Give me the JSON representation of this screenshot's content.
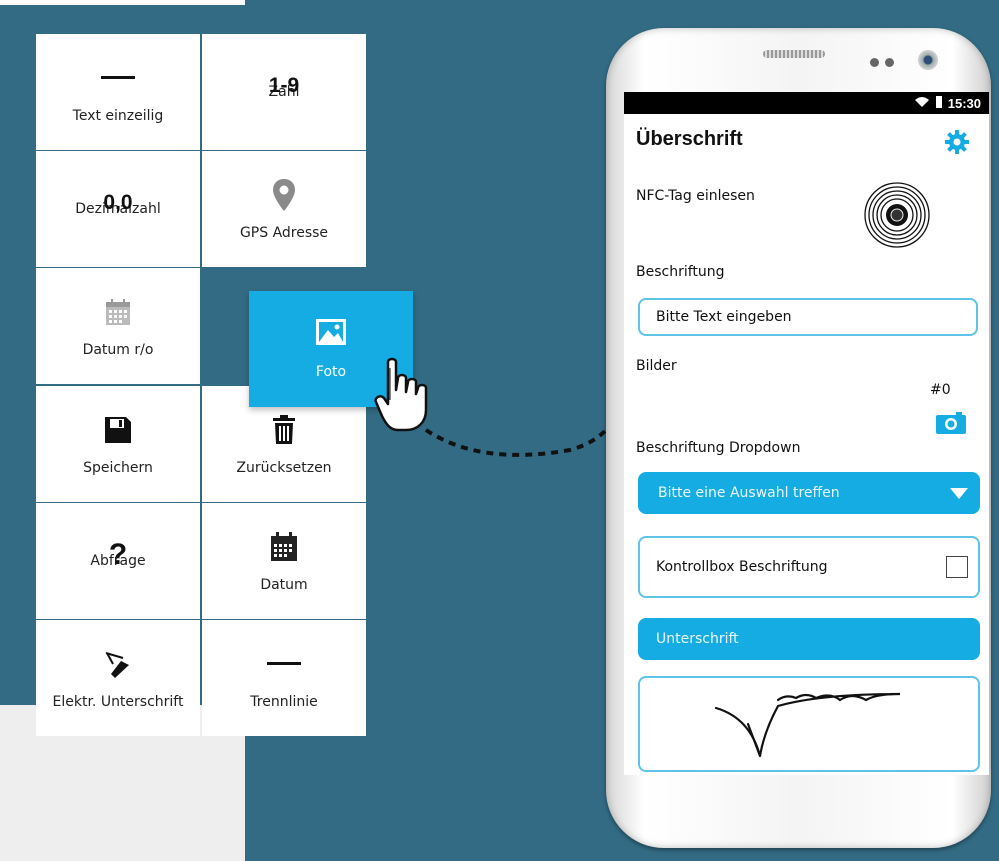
{
  "tiles": [
    {
      "key": "text_einzeilig",
      "label": "Text einzeilig",
      "icon": "horizontal-line-icon"
    },
    {
      "key": "zahl",
      "label": "Zahl",
      "icon_text": "1-9"
    },
    {
      "key": "dezimalzahl",
      "label": "Dezimalzahl",
      "icon_text": "0,0"
    },
    {
      "key": "gps",
      "label": "GPS Adresse",
      "icon": "map-pin-icon"
    },
    {
      "key": "datum_ro",
      "label": "Datum r/o",
      "icon": "calendar-icon"
    },
    {
      "key": "speichern",
      "label": "Speichern",
      "icon": "floppy-disk-icon"
    },
    {
      "key": "zuruecksetzen",
      "label": "Zurücksetzen",
      "icon": "trash-icon"
    },
    {
      "key": "abfrage",
      "label": "Abfrage",
      "icon_text": "?"
    },
    {
      "key": "datum",
      "label": "Datum",
      "icon": "calendar-icon"
    },
    {
      "key": "unterschrift",
      "label": "Elektr. Unterschrift",
      "icon": "pen-signature-icon"
    },
    {
      "key": "trennlinie",
      "label": "Trennlinie",
      "icon": "horizontal-line-icon"
    }
  ],
  "foto_tile": {
    "label": "Foto",
    "icon": "image-icon"
  },
  "status": {
    "time": "15:30"
  },
  "screen": {
    "title": "Überschrift",
    "nfc_label": "NFC-Tag einlesen",
    "beschriftung_label": "Beschriftung",
    "text_input_value": "Bitte Text eingeben",
    "bilder_label": "Bilder",
    "image_count": "#0",
    "dropdown_label": "Beschriftung Dropdown",
    "dropdown_value": "Bitte eine Auswahl treffen",
    "checkbox_label": "Kontrollbox Beschriftung",
    "signature_label": "Unterschrift"
  },
  "colors": {
    "accent": "#14ace3",
    "background": "#336b84",
    "field_border": "#5ec3e6"
  }
}
